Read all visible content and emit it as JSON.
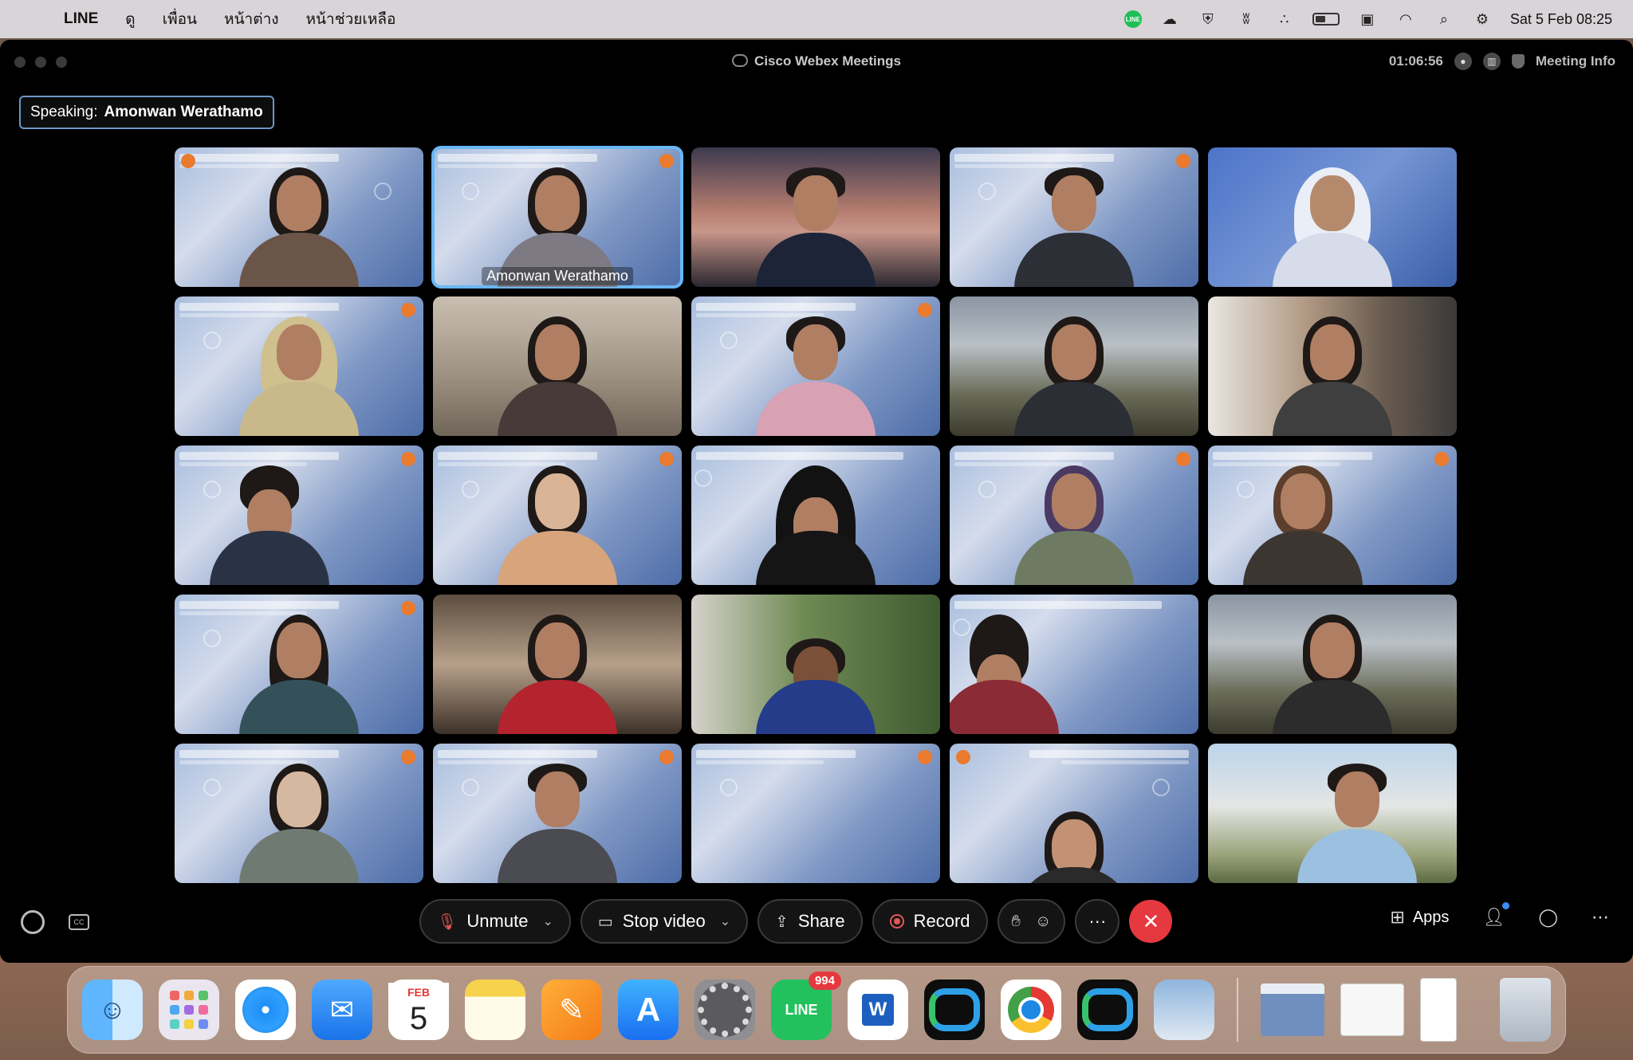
{
  "menubar": {
    "app_name": "LINE",
    "menus": [
      "ดู",
      "เพื่อน",
      "หน้าต่าง",
      "หน้าช่วยเหลือ"
    ],
    "clock": "Sat 5 Feb  08:25",
    "status_icons": [
      "line-icon",
      "creative-cloud-icon",
      "shield-icon",
      "webex-icon",
      "bluetooth-icon",
      "battery-icon",
      "notion-icon",
      "wifi-icon",
      "search-icon",
      "control-center-icon"
    ]
  },
  "window": {
    "title": "Cisco Webex Meetings",
    "timer": "01:06:56",
    "meeting_info": "Meeting Info"
  },
  "speaking": {
    "prefix": "Speaking:",
    "name": "Amonwan Werathamo"
  },
  "grid": {
    "active_name": "Amonwan Werathamo"
  },
  "controls": {
    "unmute": "Unmute",
    "stop_video": "Stop video",
    "share": "Share",
    "record": "Record",
    "more": "···",
    "apps": "Apps"
  },
  "dock": {
    "calendar_month": "FEB",
    "calendar_day": "5",
    "line_label": "LINE",
    "line_badge": "994"
  },
  "colors": {
    "end_call": "#e5393f",
    "active_border": "#6ab7f5",
    "mic_off": "#e05757"
  }
}
